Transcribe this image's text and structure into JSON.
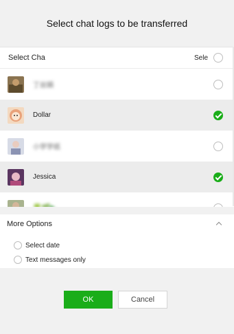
{
  "dialog": {
    "title": "Select chat logs to be transferred"
  },
  "list": {
    "header_label": "Select Cha",
    "select_all_label": "Sele",
    "contacts": [
      {
        "name": "丁丝娟",
        "blurred": true,
        "checked": false
      },
      {
        "name": "Dollar",
        "blurred": false,
        "checked": true
      },
      {
        "name": "小学学纸",
        "blurred": true,
        "checked": false
      },
      {
        "name": "Jessica",
        "blurred": false,
        "checked": true
      },
      {
        "name": "🍀🌿▶",
        "blurred": true,
        "checked": false
      }
    ]
  },
  "more_options": {
    "title": "More Options",
    "options": [
      {
        "label": "Select date",
        "checked": false
      },
      {
        "label": "Text messages only",
        "checked": false
      }
    ]
  },
  "buttons": {
    "ok": "OK",
    "cancel": "Cancel"
  },
  "colors": {
    "accent": "#1aad19",
    "background": "#f1f1f1"
  }
}
